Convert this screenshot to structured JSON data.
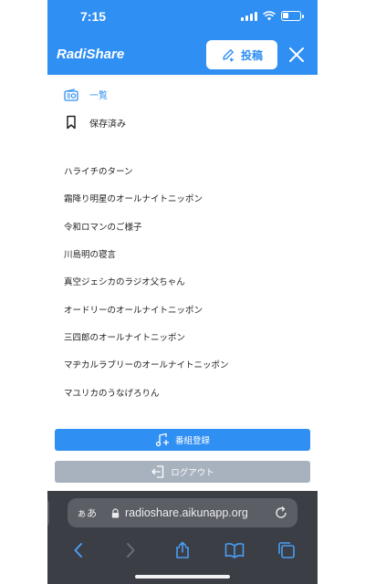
{
  "status": {
    "time": "7:15"
  },
  "header": {
    "brand": "RadiShare",
    "post_label": "投稿"
  },
  "nav": [
    {
      "label": "一覧"
    },
    {
      "label": "保存済み"
    }
  ],
  "programs": [
    "ハライチのターン",
    "霜降り明星のオールナイトニッポン",
    "令和ロマンのご様子",
    "川島明の寝言",
    "真空ジェシカのラジオ父ちゃん",
    "オードリーのオールナイトニッポン",
    "三四郎のオールナイトニッポン",
    "マヂカルラブリーのオールナイトニッポン",
    "マユリカのうなげろりん"
  ],
  "actions": {
    "register_label": "番組登録",
    "logout_label": "ログアウト"
  },
  "browser": {
    "aa_label": "ぁあ",
    "url": "radioshare.aikunapp.org"
  },
  "colors": {
    "accent": "#2f8ff2",
    "logout": "#a8b1be",
    "chrome": "#3b3e44"
  }
}
